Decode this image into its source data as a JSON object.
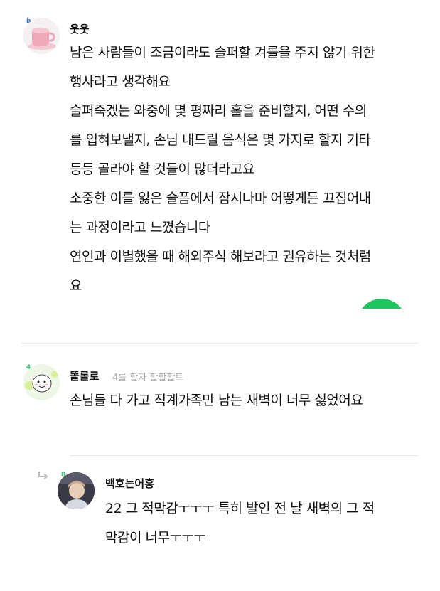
{
  "comments": [
    {
      "nickname": "웃웃",
      "level": "b",
      "lines": [
        "남은 사람들이 조금이라도 슬퍼할 겨를을 주지 않기 위한",
        "행사라고 생각해요",
        "슬퍼죽겠는 와중에 몇 평짜리 홀을 준비할지, 어떤 수의",
        "를 입혀보낼지, 손님 내드릴 음식은 몇 가지로 할지 기타",
        "등등 골라야 할 것들이 많더라고요",
        "소중한 이를 잃은 슬픔에서 잠시나마 어떻게든 끄집어내",
        "는 과정이라고 느꼈습니다",
        "연인과 이별했을 때 해외주식 해보라고 권유하는 것처럼",
        "요"
      ]
    },
    {
      "nickname": "똘롤로",
      "level": "4",
      "meta": "4를 할자 할할할트",
      "lines": [
        "손님들 다 가고 직계가족만 남는 새벽이 너무 싫었어요"
      ]
    },
    {
      "nickname": "백호는어흥",
      "level": "8",
      "lines": [
        "22 그 적막감ㅜㅜㅜ 특히 발인 전 날 새벽의 그 적",
        "막감이 너무ㅜㅜㅜ"
      ]
    }
  ],
  "colors": {
    "accent_green": "#1ec660",
    "badge_blue": "#3b78d8",
    "badge_green": "#2fbf71",
    "meta_gray": "#aaaaaa"
  }
}
